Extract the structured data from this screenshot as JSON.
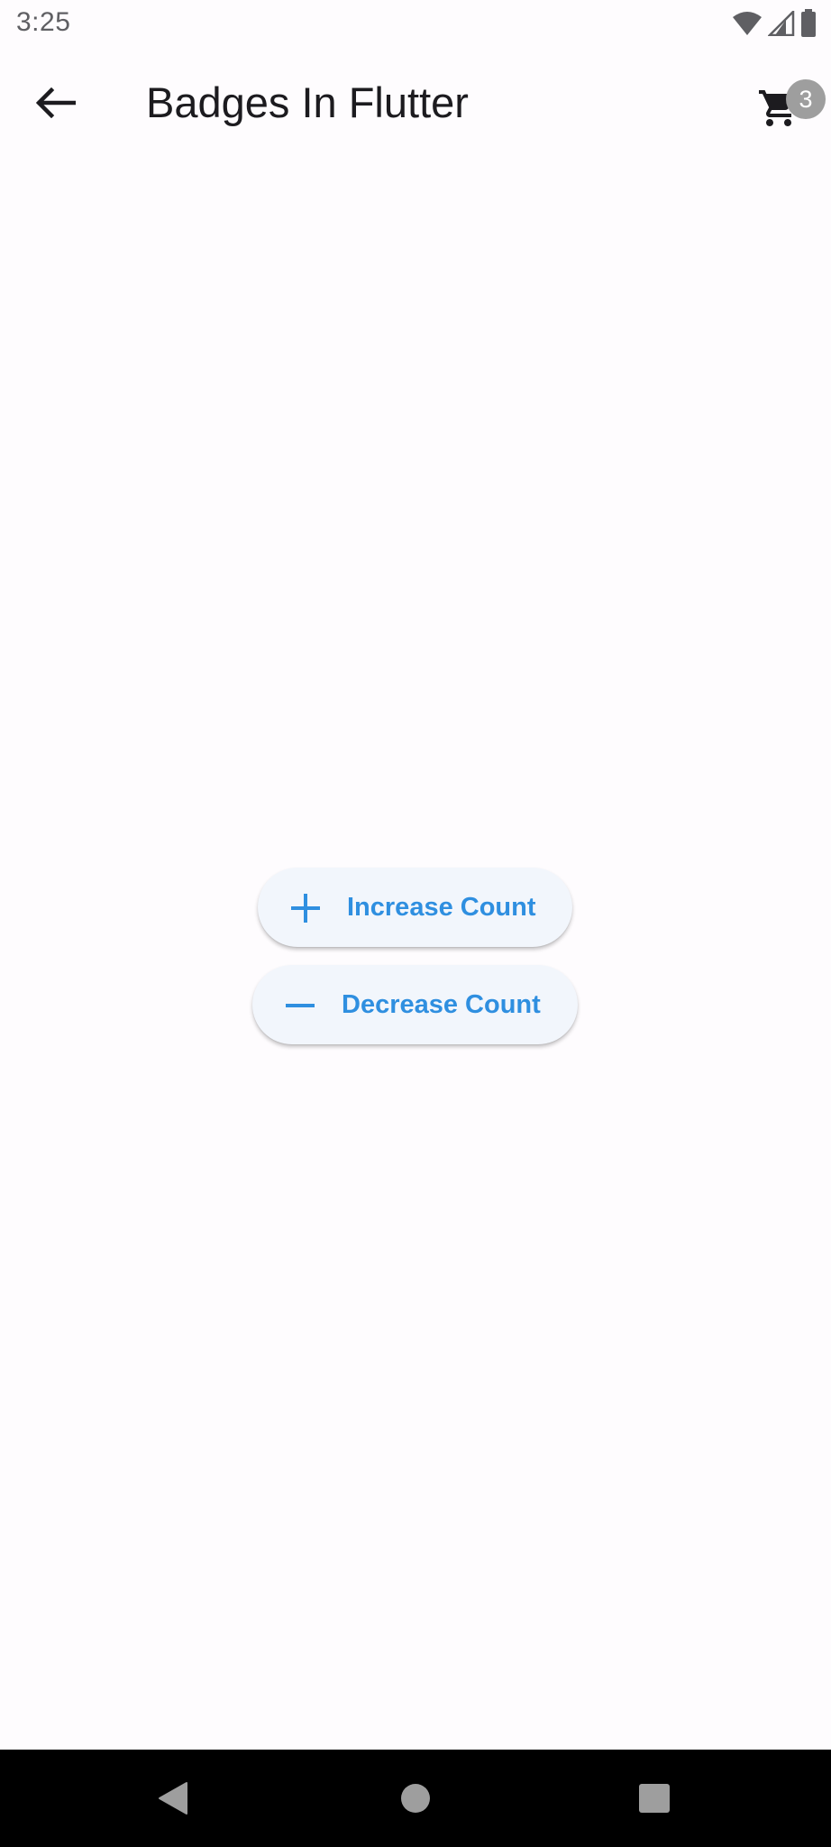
{
  "status_bar": {
    "time": "3:25",
    "icons": [
      "wifi-icon",
      "cell-signal-icon",
      "battery-icon"
    ]
  },
  "app_bar": {
    "back_icon": "arrow-back-icon",
    "title": "Badges In Flutter",
    "cart_icon": "shopping-cart-icon",
    "cart_badge_count": "3"
  },
  "actions": {
    "increase": {
      "icon": "add-icon",
      "label": "Increase Count"
    },
    "decrease": {
      "icon": "remove-icon",
      "label": "Decrease Count"
    }
  },
  "nav_bar": {
    "items": [
      "nav-back-icon",
      "nav-home-icon",
      "nav-recents-icon"
    ]
  },
  "colors": {
    "background": "#fefcfe",
    "accent": "#2f8fe0",
    "button_bg": "#f2f6fc",
    "badge": "#9e9e9e",
    "nav_bar": "#000000"
  }
}
